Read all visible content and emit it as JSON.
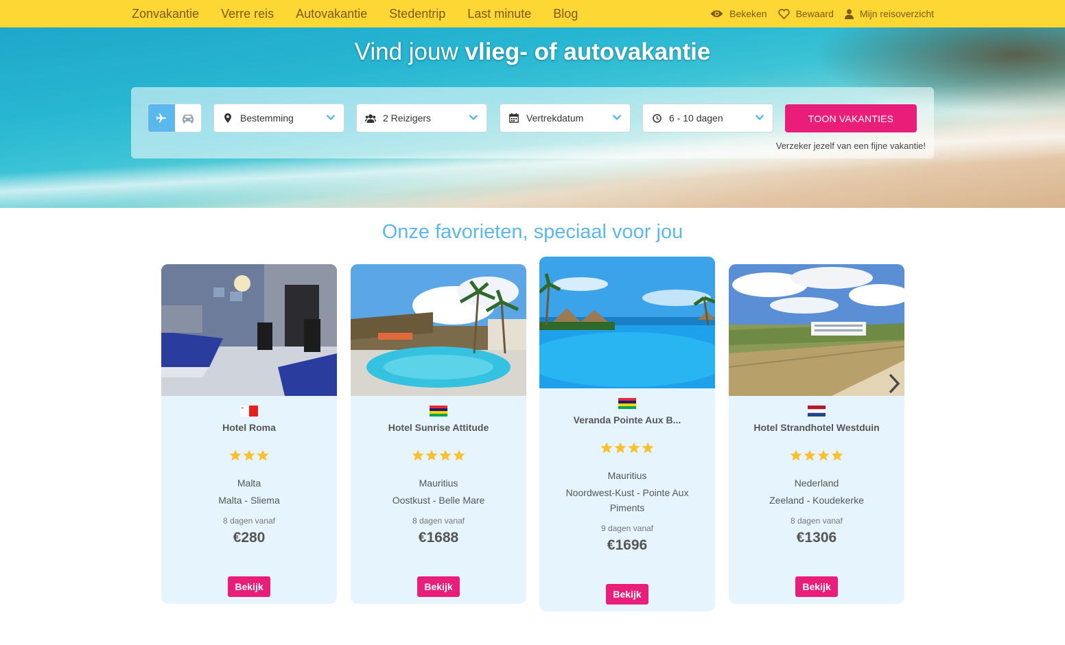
{
  "nav": {
    "menu": [
      "Zonvakantie",
      "Verre reis",
      "Autovakantie",
      "Stedentrip",
      "Last minute",
      "Blog"
    ],
    "right": [
      {
        "label": "Bekeken",
        "icon": "eye-icon"
      },
      {
        "label": "Bewaard",
        "icon": "heart-icon"
      },
      {
        "label": "Mijn reisoverzicht",
        "icon": "user-icon"
      }
    ]
  },
  "hero": {
    "title_regular": "Vind jouw",
    "title_bold": "vlieg- of autovakantie"
  },
  "search": {
    "transport_modes": [
      {
        "icon": "plane-icon",
        "active": true
      },
      {
        "icon": "car-icon",
        "active": false
      }
    ],
    "destination": "Bestemming",
    "travelers": "2 Reizigers",
    "departure": "Vertrekdatum",
    "duration": "6 - 10 dagen",
    "submit": "TOON VAKANTIES",
    "insure_text": "Verzeker jezelf van een fijne vakantie!"
  },
  "favorites": {
    "title": "Onze favorieten, speciaal voor jou",
    "cta": "Bekijk",
    "cards": [
      {
        "name": "Hotel Roma",
        "stars": 3,
        "country": "Malta",
        "region": "Malta - Sliema",
        "days": "8 dagen vanaf",
        "price": "€280",
        "flag": "malta",
        "highlighted": false
      },
      {
        "name": "Hotel Sunrise Attitude",
        "stars": 4,
        "country": "Mauritius",
        "region": "Oostkust - Belle Mare",
        "days": "8 dagen vanaf",
        "price": "€1688",
        "flag": "mauritius",
        "highlighted": false
      },
      {
        "name": "Veranda Pointe Aux B...",
        "stars": 4,
        "country": "Mauritius",
        "region": "Noordwest-Kust - Pointe Aux Piments",
        "days": "9 dagen vanaf",
        "price": "€1696",
        "flag": "mauritius",
        "highlighted": true
      },
      {
        "name": "Hotel Strandhotel Westduin",
        "stars": 4,
        "country": "Nederland",
        "region": "Zeeland - Koudekerke",
        "days": "8 dagen vanaf",
        "price": "€1306",
        "flag": "netherlands",
        "highlighted": false
      }
    ]
  },
  "colors": {
    "nav_bg": "#fdd835",
    "nav_text": "#7a5a16",
    "accent_pink": "#e91e7a",
    "accent_blue": "#5ab8ef",
    "card_bg": "#e6f4fd",
    "star": "#fbc02d"
  }
}
